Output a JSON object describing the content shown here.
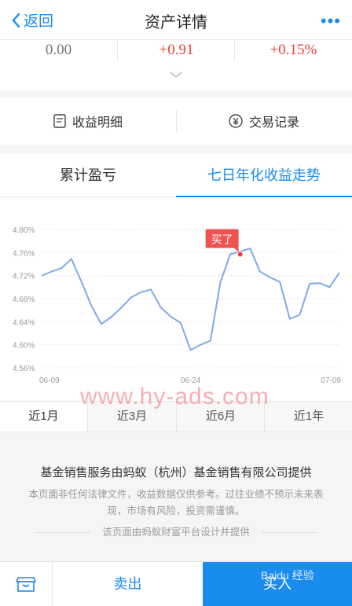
{
  "header": {
    "back_label": "返回",
    "title": "资产详情",
    "more_label": "•••"
  },
  "stats": [
    "0.00",
    "+0.91",
    "+0.15%"
  ],
  "quick_links": [
    "收益明细",
    "交易记录"
  ],
  "tabs": [
    "累计盈亏",
    "七日年化收益走势"
  ],
  "chart_data": {
    "type": "line",
    "x": [
      "06-09",
      "06-10",
      "06-11",
      "06-12",
      "06-13",
      "06-14",
      "06-15",
      "06-16",
      "06-17",
      "06-18",
      "06-19",
      "06-20",
      "06-21",
      "06-22",
      "06-23",
      "06-24",
      "06-25",
      "06-26",
      "06-27",
      "06-28",
      "06-29",
      "06-30",
      "07-01",
      "07-02",
      "07-03",
      "07-04",
      "07-05",
      "07-06",
      "07-07",
      "07-08",
      "07-09"
    ],
    "series": [
      {
        "values": [
          4.72,
          4.727,
          4.733,
          4.749,
          4.71,
          4.668,
          4.636,
          4.648,
          4.664,
          4.682,
          4.691,
          4.696,
          4.665,
          4.649,
          4.638,
          4.591,
          4.6,
          4.607,
          4.708,
          4.757,
          4.762,
          4.767,
          4.727,
          4.717,
          4.709,
          4.645,
          4.652,
          4.706,
          4.707,
          4.7,
          4.725
        ]
      }
    ],
    "x_ticks": [
      "06-09",
      "06-24",
      "07-09"
    ],
    "y_ticks": [
      "4.56%",
      "4.60%",
      "4.64%",
      "4.68%",
      "4.72%",
      "4.76%",
      "4.80%"
    ],
    "ylim": [
      4.56,
      4.8
    ],
    "annotation": {
      "label": "买了",
      "x": "06-29",
      "y": 4.757
    },
    "line_color": "#7fa9e6",
    "marker_color": "#e8413b"
  },
  "ranges": [
    "近1月",
    "近3月",
    "近6月",
    "近1年"
  ],
  "footer": {
    "title": "基金销售服务由蚂蚁（杭州）基金销售有限公司提供",
    "disclaimer": "本页面非任何法律文件，收益数据仅供参考。过往业绩不预示未来表现，市场有风险，投资需谨慎。",
    "design_note": "该页面由蚂蚁财富平台设计并提供"
  },
  "bottom_bar": {
    "sell_label": "卖出",
    "buy_label": "买入"
  },
  "watermark_text": "www.hy-ads.com",
  "baidu_text": "Baidu 经验",
  "colors": {
    "accent": "#1a8cf0",
    "up": "#e8413b"
  }
}
